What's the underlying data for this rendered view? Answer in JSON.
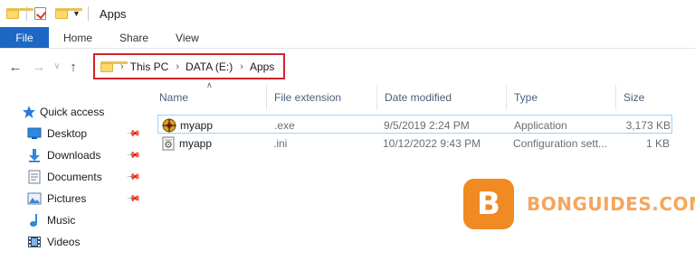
{
  "window": {
    "title": "Apps"
  },
  "ribbon": {
    "tabs": [
      "File",
      "Home",
      "Share",
      "View"
    ]
  },
  "address": {
    "crumbs": [
      "This PC",
      "DATA (E:)",
      "Apps"
    ]
  },
  "columns": [
    "Name",
    "File extension",
    "Date modified",
    "Type",
    "Size"
  ],
  "sidebar": {
    "items": [
      {
        "label": "Quick access",
        "icon": "star-icon"
      },
      {
        "label": "Desktop",
        "icon": "desktop-icon",
        "pinned": true
      },
      {
        "label": "Downloads",
        "icon": "download-icon",
        "pinned": true
      },
      {
        "label": "Documents",
        "icon": "documents-icon",
        "pinned": true
      },
      {
        "label": "Pictures",
        "icon": "pictures-icon",
        "pinned": true
      },
      {
        "label": "Music",
        "icon": "music-icon"
      },
      {
        "label": "Videos",
        "icon": "videos-icon"
      }
    ]
  },
  "files": [
    {
      "name": "myapp",
      "extension": ".exe",
      "modified": "9/5/2019 2:24 PM",
      "type": "Application",
      "size": "3,173 KB",
      "icon": "application-icon",
      "selected": true
    },
    {
      "name": "myapp",
      "extension": ".ini",
      "modified": "10/12/2022 9:43 PM",
      "type": "Configuration sett...",
      "size": "1 KB",
      "icon": "settings-file-icon",
      "selected": false
    }
  ],
  "watermark": {
    "letter": "B",
    "text": "BONGUIDES.COM"
  },
  "colors": {
    "file_tab": "#1e67c4",
    "address_highlight": "#d1232a",
    "header_text": "#4c607a",
    "watermark": "#f08a22"
  }
}
